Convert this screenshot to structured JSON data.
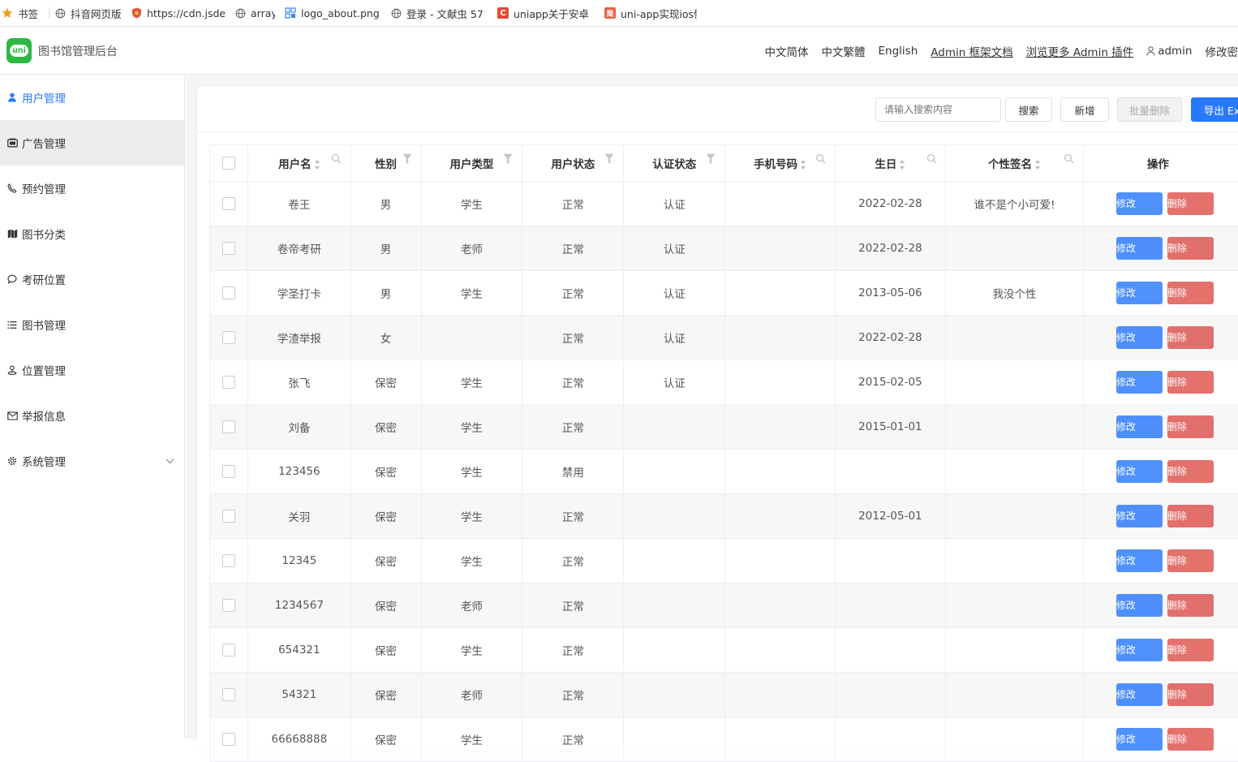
{
  "bookmarks": [
    {
      "icon": "star-icon",
      "label": "书签"
    },
    {
      "icon": "globe-icon",
      "label": "抖音网页版"
    },
    {
      "icon": "shield-icon",
      "label": "https://cdn.jsdeli"
    },
    {
      "icon": "globe-icon",
      "label": "array"
    },
    {
      "icon": "image-icon",
      "label": "logo_about.png"
    },
    {
      "icon": "globe-icon",
      "label": "登录 - 文献虫  57"
    },
    {
      "icon": "csdn-icon",
      "label": "uniapp关于安卓"
    },
    {
      "icon": "jianshu-icon",
      "label": "uni-app实现ios侧"
    }
  ],
  "header": {
    "logo_text": "uni",
    "title": "图书馆管理后台",
    "nav": {
      "lang_simplified": "中文简体",
      "lang_traditional": "中文繁體",
      "lang_english": "English",
      "docs_link": "Admin 框架文档",
      "plugins_link": "浏览更多 Admin 插件",
      "user": "admin",
      "change_password": "修改密"
    }
  },
  "sidebar": {
    "items": [
      {
        "icon": "user-icon",
        "label": "用户管理"
      },
      {
        "icon": "image-icon",
        "label": "广告管理"
      },
      {
        "icon": "phone-icon",
        "label": "预约管理"
      },
      {
        "icon": "map-icon",
        "label": "图书分类"
      },
      {
        "icon": "chat-bubble-icon",
        "label": "考研位置"
      },
      {
        "icon": "list-icon",
        "label": "图书管理"
      },
      {
        "icon": "location-icon",
        "label": "位置管理"
      },
      {
        "icon": "mail-icon",
        "label": "举报信息"
      },
      {
        "icon": "gear-icon",
        "label": "系统管理"
      }
    ]
  },
  "toolbar": {
    "search_placeholder": "请输入搜索内容",
    "search_label": "搜索",
    "add_label": "新增",
    "batch_delete_label": "批量删除",
    "export_label": "导出 Exc"
  },
  "table": {
    "columns": [
      "用户名",
      "性别",
      "用户类型",
      "用户状态",
      "认证状态",
      "手机号码",
      "生日",
      "个性签名",
      "操作"
    ],
    "edit_label": "修改",
    "delete_label": "删除",
    "rows": [
      {
        "username": "卷王",
        "gender": "男",
        "type": "学生",
        "status": "正常",
        "auth": "认证",
        "phone": "",
        "birthday": "2022-02-28",
        "signature": "谁不是个小可爱!"
      },
      {
        "username": "卷帝考研",
        "gender": "男",
        "type": "老师",
        "status": "正常",
        "auth": "认证",
        "phone": "",
        "birthday": "2022-02-28",
        "signature": ""
      },
      {
        "username": "学圣打卡",
        "gender": "男",
        "type": "学生",
        "status": "正常",
        "auth": "认证",
        "phone": "",
        "birthday": "2013-05-06",
        "signature": "我没个性"
      },
      {
        "username": "学渣举报",
        "gender": "女",
        "type": "",
        "status": "正常",
        "auth": "认证",
        "phone": "",
        "birthday": "2022-02-28",
        "signature": ""
      },
      {
        "username": "张飞",
        "gender": "保密",
        "type": "学生",
        "status": "正常",
        "auth": "认证",
        "phone": "",
        "birthday": "2015-02-05",
        "signature": ""
      },
      {
        "username": "刘备",
        "gender": "保密",
        "type": "学生",
        "status": "正常",
        "auth": "",
        "phone": "",
        "birthday": "2015-01-01",
        "signature": ""
      },
      {
        "username": "123456",
        "gender": "保密",
        "type": "学生",
        "status": "禁用",
        "auth": "",
        "phone": "",
        "birthday": "",
        "signature": ""
      },
      {
        "username": "关羽",
        "gender": "保密",
        "type": "学生",
        "status": "正常",
        "auth": "",
        "phone": "",
        "birthday": "2012-05-01",
        "signature": ""
      },
      {
        "username": "12345",
        "gender": "保密",
        "type": "学生",
        "status": "正常",
        "auth": "",
        "phone": "",
        "birthday": "",
        "signature": ""
      },
      {
        "username": "1234567",
        "gender": "保密",
        "type": "老师",
        "status": "正常",
        "auth": "",
        "phone": "",
        "birthday": "",
        "signature": ""
      },
      {
        "username": "654321",
        "gender": "保密",
        "type": "学生",
        "status": "正常",
        "auth": "",
        "phone": "",
        "birthday": "",
        "signature": ""
      },
      {
        "username": "54321",
        "gender": "保密",
        "type": "老师",
        "status": "正常",
        "auth": "",
        "phone": "",
        "birthday": "",
        "signature": ""
      },
      {
        "username": "66668888",
        "gender": "保密",
        "type": "学生",
        "status": "正常",
        "auth": "",
        "phone": "",
        "birthday": "",
        "signature": ""
      }
    ]
  }
}
